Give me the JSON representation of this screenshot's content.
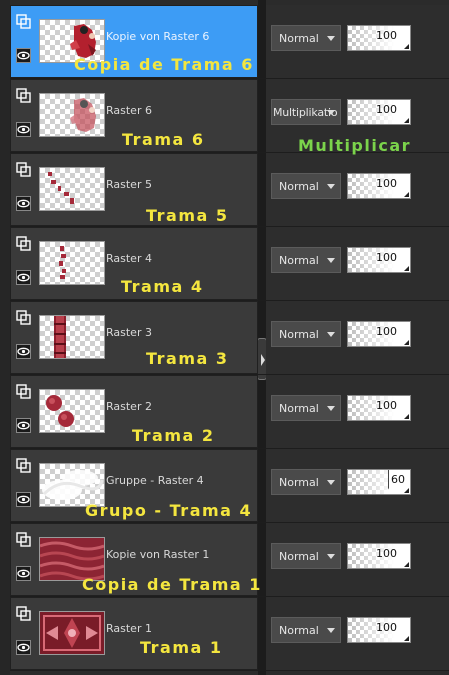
{
  "layers": [
    {
      "name": "Kopie von Raster 6",
      "caption": "Copia de Trama 6",
      "blend": "Normal",
      "opacity": "100",
      "active": true
    },
    {
      "name": "Raster 6",
      "caption": "Trama 6",
      "blend": "Multiplikatio",
      "opacity": "100"
    },
    {
      "name": "Raster 5",
      "caption": "Trama 5",
      "blend": "Normal",
      "opacity": "100"
    },
    {
      "name": "Raster 4",
      "caption": "Trama 4",
      "blend": "Normal",
      "opacity": "100"
    },
    {
      "name": "Raster 3",
      "caption": "Trama 3",
      "blend": "Normal",
      "opacity": "100"
    },
    {
      "name": "Raster 2",
      "caption": "Trama 2",
      "blend": "Normal",
      "opacity": "100"
    },
    {
      "name": "Gruppe - Raster 4",
      "caption": "Grupo - Trama 4",
      "blend": "Normal",
      "opacity": "60"
    },
    {
      "name": "Kopie von Raster 1",
      "caption": "Copia de Trama 1",
      "blend": "Normal",
      "opacity": "100"
    },
    {
      "name": "Raster 1",
      "caption": "Trama 1",
      "blend": "Normal",
      "opacity": "100"
    }
  ],
  "annotation_multiply": "Multiplicar",
  "colors": {
    "active": "#3d9cf5",
    "caption": "#f4e63f",
    "annotation": "#7bd34b",
    "accent": "#a52a3a"
  },
  "icons": [
    "layer-group-icon",
    "eye-icon",
    "dropdown-arrow-icon"
  ]
}
